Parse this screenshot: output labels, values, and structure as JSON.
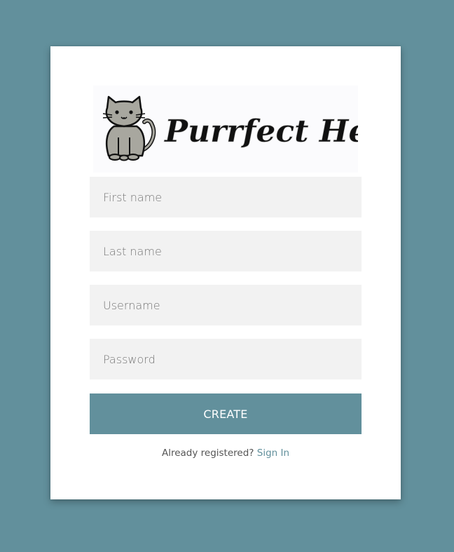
{
  "brand": {
    "logo_text": "Purrfect Health"
  },
  "form": {
    "first_name_placeholder": "First name",
    "last_name_placeholder": "Last name",
    "username_placeholder": "Username",
    "password_placeholder": "Password",
    "create_label": "CREATE"
  },
  "footer": {
    "prompt": "Already registered?",
    "sign_in_label": "Sign In"
  },
  "colors": {
    "background": "#62909c",
    "card": "#ffffff",
    "field": "#f2f2f2",
    "accent": "#62909c"
  },
  "icons": [
    "cat-icon"
  ]
}
